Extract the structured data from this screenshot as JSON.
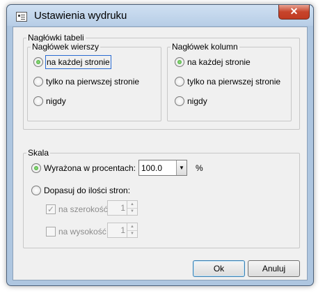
{
  "window": {
    "title": "Ustawienia wydruku",
    "close_glyph": "✕"
  },
  "table_headers": {
    "legend": "Nagłówki tabeli",
    "rows": {
      "legend": "Nagłówek wierszy",
      "options": [
        "na każdej stronie",
        "tylko na pierwszej stronie",
        "nigdy"
      ],
      "selected": 0
    },
    "columns": {
      "legend": "Nagłówek kolumn",
      "options": [
        "na każdej stronie",
        "tylko na pierwszej stronie",
        "nigdy"
      ],
      "selected": 0
    }
  },
  "scale": {
    "legend": "Skala",
    "percent_label": "Wyrażona w procentach:",
    "percent_value": "100.0",
    "percent_unit": "%",
    "fit_label": "Dopasuj do ilości stron:",
    "width_label": "na szerokość",
    "width_checked": true,
    "width_value": "1",
    "height_label": "na wysokość",
    "height_checked": false,
    "height_value": "1"
  },
  "buttons": {
    "ok": "Ok",
    "cancel": "Anuluj"
  },
  "icons": {
    "app": "document-settings-icon",
    "close": "close-icon",
    "combo_arrow": "▼"
  }
}
